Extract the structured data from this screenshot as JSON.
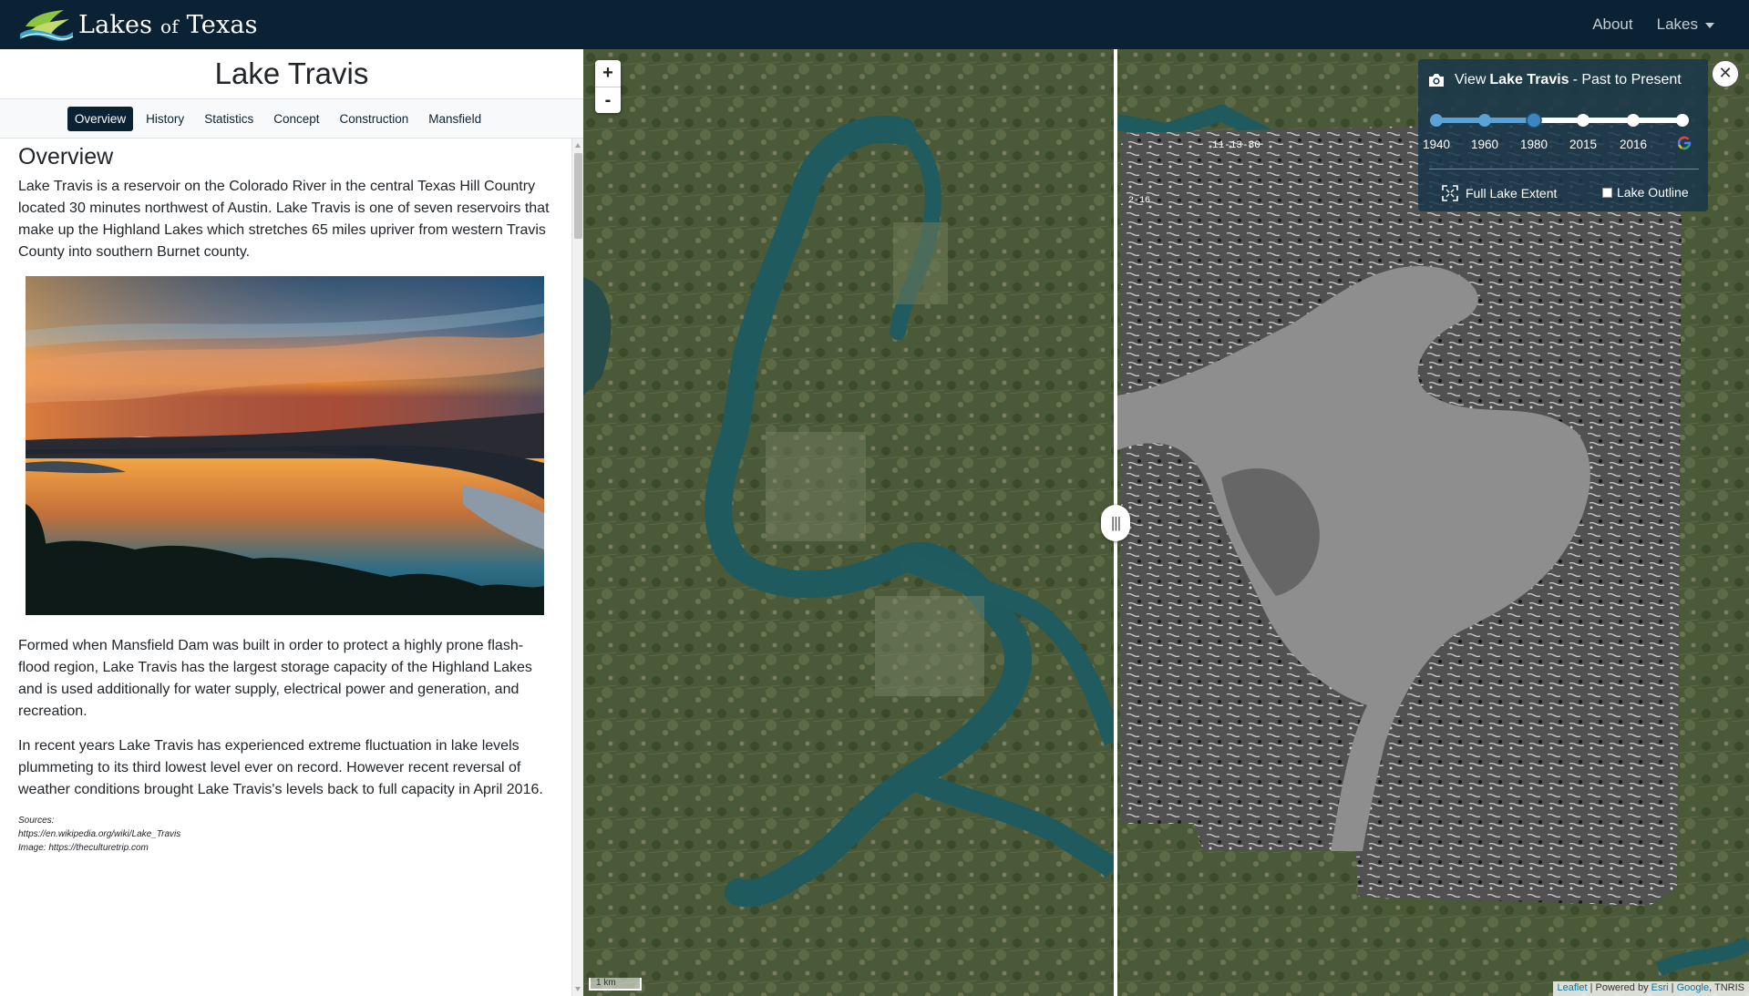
{
  "nav": {
    "brand_main": "Lakes",
    "brand_of": "of",
    "brand_end": "Texas",
    "about": "About",
    "lakes": "Lakes",
    "logo_icon": "lake-wave-logo"
  },
  "lake": {
    "title": "Lake Travis",
    "tabs": [
      "Overview",
      "History",
      "Statistics",
      "Concept",
      "Construction",
      "Mansfield"
    ],
    "active_tab": "Overview"
  },
  "content": {
    "heading": "Overview",
    "p1": "Lake Travis is a reservoir on the Colorado River in the central Texas Hill Country located 30 minutes northwest of Austin. Lake Travis is one of seven reservoirs that make up the Highland Lakes which stretches 65 miles upriver from western Travis County into southern Burnet county.",
    "p2": "Formed when Mansfield Dam was built in order to protect a highly prone flash-flood region, Lake Travis has the largest storage capacity of the Highland Lakes and is used additionally for water supply, electrical power and generation, and recreation.",
    "p3": "In recent years Lake Travis has experienced extreme fluctuation in lake levels plummeting to its third lowest level ever on record. However recent reversal of weather conditions brought Lake Travis's levels back to full capacity in April 2016.",
    "sources_label": "Sources:",
    "source1": "https://en.wikipedia.org/wiki/Lake_Travis",
    "source2": "Image: https://theculturetrip.com"
  },
  "map": {
    "zoom_in": "+",
    "zoom_out": "-",
    "handle": "|||",
    "scale": "1 km",
    "attr_leaflet": "Leaflet",
    "attr_powered": " | Powered by ",
    "attr_esri": "Esri",
    "attr_sep": " | ",
    "attr_google": "Google",
    "attr_tnris": ", TNRIS",
    "photo_stamp1": "11-13-80",
    "photo_stamp2": "2-16"
  },
  "timeline": {
    "view_prefix": "View",
    "lake_name": "Lake Travis",
    "view_suffix": "- Past to Present",
    "years": [
      "1940",
      "1960",
      "1980",
      "2015",
      "2016"
    ],
    "selected_year": "1980",
    "full_extent": "Full Lake Extent",
    "lake_outline": "Lake Outline",
    "close": "✕",
    "accent": "#5ba3d6"
  }
}
